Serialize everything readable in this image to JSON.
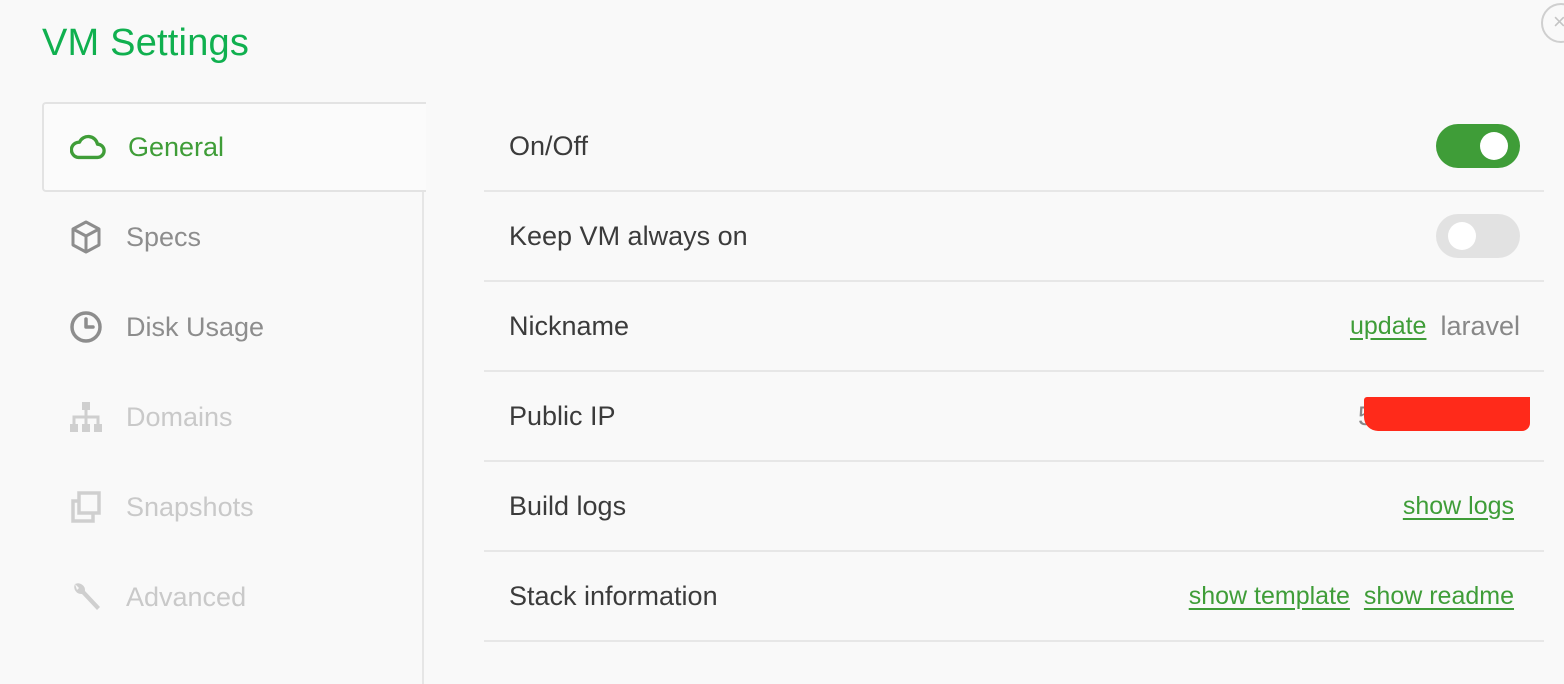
{
  "page": {
    "title": "VM Settings"
  },
  "sidebar": {
    "items": [
      {
        "label": "General",
        "icon": "cloud-icon",
        "state": "active"
      },
      {
        "label": "Specs",
        "icon": "cube-icon",
        "state": "normal"
      },
      {
        "label": "Disk Usage",
        "icon": "gauge-icon",
        "state": "normal"
      },
      {
        "label": "Domains",
        "icon": "sitemap-icon",
        "state": "disabled"
      },
      {
        "label": "Snapshots",
        "icon": "copy-icon",
        "state": "disabled"
      },
      {
        "label": "Advanced",
        "icon": "wrench-icon",
        "state": "disabled"
      }
    ]
  },
  "settings": {
    "on_off": {
      "label": "On/Off",
      "enabled": true
    },
    "keep_on": {
      "label": "Keep VM always on",
      "enabled": false
    },
    "nickname": {
      "label": "Nickname",
      "action": "update",
      "value": "laravel"
    },
    "public_ip": {
      "label": "Public IP",
      "value_partial": "5"
    },
    "build_logs": {
      "label": "Build logs",
      "action": "show logs"
    },
    "stack_info": {
      "label": "Stack information",
      "action_template": "show template",
      "action_readme": "show readme"
    }
  },
  "colors": {
    "accent": "#3f9d38",
    "title": "#10b04f",
    "redaction": "#ff2a1a"
  }
}
